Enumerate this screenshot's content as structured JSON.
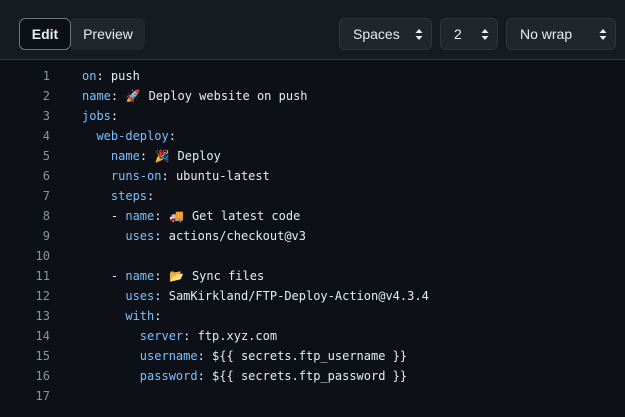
{
  "toolbar": {
    "edit_label": "Edit",
    "preview_label": "Preview",
    "indent_mode": "Spaces",
    "indent_size": "2",
    "wrap_mode": "No wrap"
  },
  "editor": {
    "lines": [
      {
        "n": "1",
        "indent": "",
        "key": "on",
        "sep": ": ",
        "value": "push",
        "emoji": ""
      },
      {
        "n": "2",
        "indent": "",
        "key": "name",
        "sep": ": ",
        "value": " Deploy website on push",
        "emoji": "🚀"
      },
      {
        "n": "3",
        "indent": "",
        "key": "jobs",
        "sep": ":",
        "value": "",
        "emoji": ""
      },
      {
        "n": "4",
        "indent": "  ",
        "key": "web-deploy",
        "sep": ":",
        "value": "",
        "emoji": ""
      },
      {
        "n": "5",
        "indent": "    ",
        "key": "name",
        "sep": ": ",
        "value": " Deploy",
        "emoji": "🎉"
      },
      {
        "n": "6",
        "indent": "    ",
        "key": "runs-on",
        "sep": ": ",
        "value": "ubuntu-latest",
        "emoji": ""
      },
      {
        "n": "7",
        "indent": "    ",
        "key": "steps",
        "sep": ":",
        "value": "",
        "emoji": ""
      },
      {
        "n": "8",
        "indent": "    - ",
        "key": "name",
        "sep": ": ",
        "value": " Get latest code",
        "emoji": "🚚"
      },
      {
        "n": "9",
        "indent": "      ",
        "key": "uses",
        "sep": ": ",
        "value": "actions/checkout@v3",
        "emoji": ""
      },
      {
        "n": "10",
        "indent": "",
        "key": "",
        "sep": "",
        "value": "",
        "emoji": ""
      },
      {
        "n": "11",
        "indent": "    - ",
        "key": "name",
        "sep": ": ",
        "value": " Sync files",
        "emoji": "📂"
      },
      {
        "n": "12",
        "indent": "      ",
        "key": "uses",
        "sep": ": ",
        "value": "SamKirkland/FTP-Deploy-Action@v4.3.4",
        "emoji": ""
      },
      {
        "n": "13",
        "indent": "      ",
        "key": "with",
        "sep": ":",
        "value": "",
        "emoji": ""
      },
      {
        "n": "14",
        "indent": "        ",
        "key": "server",
        "sep": ": ",
        "value": "ftp.xyz.com",
        "emoji": ""
      },
      {
        "n": "15",
        "indent": "        ",
        "key": "username",
        "sep": ": ",
        "value": "${{ secrets.ftp_username }}",
        "emoji": ""
      },
      {
        "n": "16",
        "indent": "        ",
        "key": "password",
        "sep": ": ",
        "value": "${{ secrets.ftp_password }}",
        "emoji": ""
      },
      {
        "n": "17",
        "indent": "",
        "key": "",
        "sep": "",
        "value": "",
        "emoji": ""
      }
    ]
  },
  "colors": {
    "background": "#0d1117",
    "toolbar": "#161b22",
    "key": "#79c0ff",
    "text": "#e6edf3",
    "line_number": "#8b949e"
  }
}
